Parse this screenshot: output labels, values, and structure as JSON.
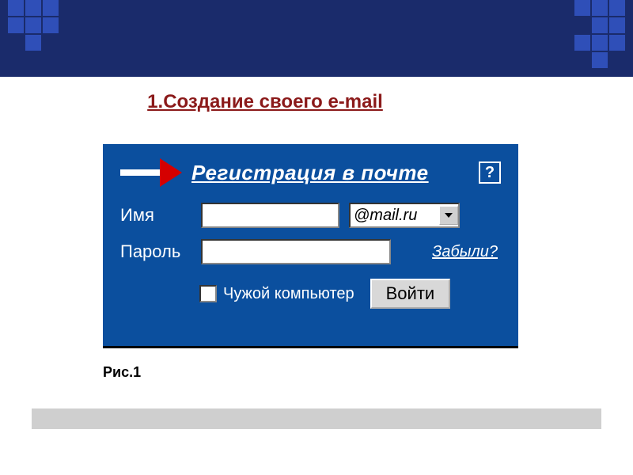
{
  "heading": "1.Создание своего e-mail",
  "panel": {
    "register_link": "Регистрация в почте",
    "help_symbol": "?",
    "name_label": "Имя",
    "name_value": "",
    "domain_selected": "@mail.ru",
    "password_label": "Пароль",
    "password_value": "",
    "forgot_label": "Забыли?",
    "foreign_pc_label": "Чужой компьютер",
    "login_button": "Войти"
  },
  "caption": "Рис.1"
}
